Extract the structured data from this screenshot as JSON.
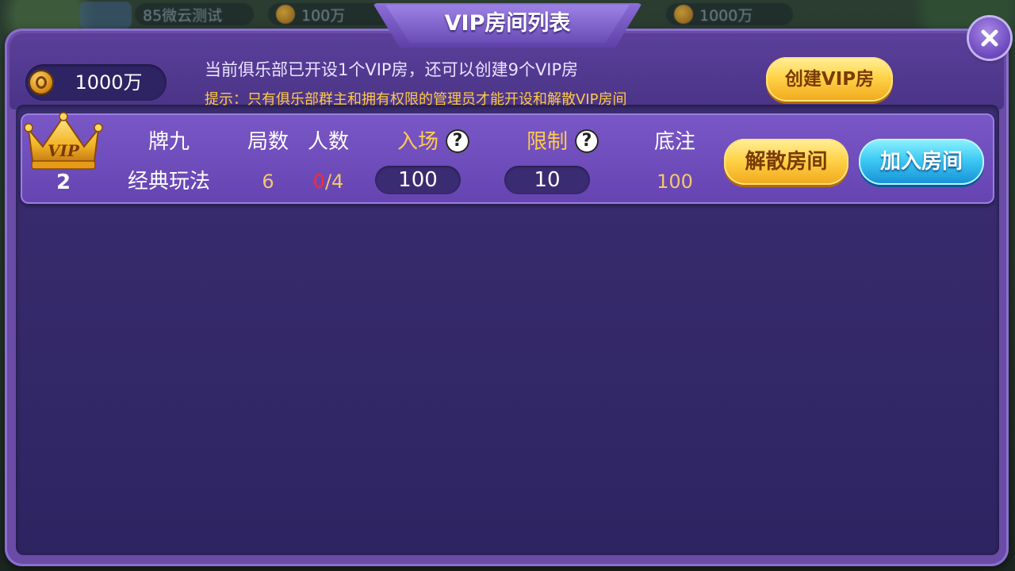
{
  "background": {
    "club_name": "85微云测试",
    "chip_amount": "100万",
    "gold_amount": "1000万"
  },
  "dialog": {
    "title": "VIP房间列表",
    "gold": "1000万",
    "info": "当前俱乐部已开设1个VIP房，还可以创建9个VIP房",
    "hint": "提示：只有俱乐部群主和拥有权限的管理员才能开设和解散VIP房间",
    "create_button": "创建VIP房"
  },
  "room": {
    "vip_badge": "VIP",
    "number": "2",
    "game_name": "牌九",
    "mode": "经典玩法",
    "rounds_label": "局数",
    "rounds_value": "6",
    "players_label": "人数",
    "players_current": "0",
    "players_max": "/4",
    "entry_label": "入场",
    "entry_value": "100",
    "limit_label": "限制",
    "limit_value": "10",
    "base_label": "底注",
    "base_value": "100",
    "help_glyph": "?",
    "dissolve_button": "解散房间",
    "join_button": "加入房间"
  },
  "colors": {
    "dialog": "#6a4ca6",
    "panel": "#2e2462",
    "accent_gold": "#ffcb4e",
    "hint": "#ffc947",
    "players_current": "#ff2a2a"
  },
  "icons": [
    "close-icon",
    "gold-coin-icon",
    "vip-crown-icon",
    "help-icon"
  ]
}
